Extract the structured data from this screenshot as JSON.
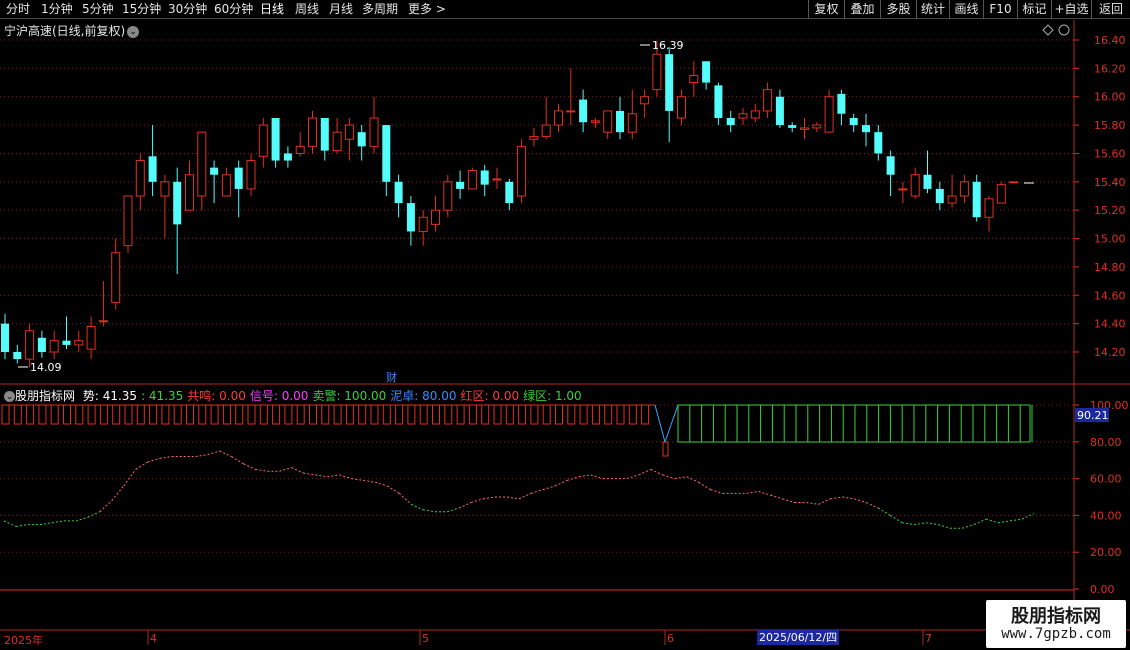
{
  "toolbar": {
    "periods": [
      "分时",
      "1分钟",
      "5分钟",
      "15分钟",
      "30分钟",
      "60分钟",
      "日线",
      "周线",
      "月线",
      "多周期",
      "更多 >"
    ],
    "actions": [
      "复权",
      "叠加",
      "多股",
      "统计",
      "画线",
      "F10",
      "标记",
      "+自选",
      "返回"
    ]
  },
  "stock": {
    "title": "宁沪高速(日线,前复权)",
    "high_label": "16.39",
    "low_label": "14.09",
    "finance_marker": "财"
  },
  "indicator": {
    "name": "股朋指标网",
    "items": [
      {
        "label": "势:",
        "value": "41.35",
        "color": "#ffffff"
      },
      {
        "label": ":",
        "value": "41.35",
        "color": "#39d23a"
      },
      {
        "label": "共鸣:",
        "value": "0.00",
        "color": "#ff3a3a"
      },
      {
        "label": "信号:",
        "value": "0.00",
        "color": "#ff3aff"
      },
      {
        "label": "卖警:",
        "value": "100.00",
        "color": "#39d23a"
      },
      {
        "label": "泥卓:",
        "value": "80.00",
        "color": "#3a8cff"
      },
      {
        "label": "红区:",
        "value": "0.00",
        "color": "#ff3a3a"
      },
      {
        "label": "绿区:",
        "value": "1.00",
        "color": "#39d23a"
      }
    ],
    "current_value": "90.21"
  },
  "price_axis": [
    "16.40",
    "16.20",
    "16.00",
    "15.80",
    "15.60",
    "15.40",
    "15.20",
    "15.00",
    "14.80",
    "14.60",
    "14.40",
    "14.20"
  ],
  "ind_axis": [
    "100.00",
    "80.00",
    "60.00",
    "40.00",
    "20.00",
    "0.00"
  ],
  "dates": {
    "year": "2025年",
    "m4": "4",
    "m5": "5",
    "m6": "6",
    "m7": "7",
    "cursor": "2025/06/12/四"
  },
  "watermark": {
    "title": "股朋指标网",
    "url": "www.7gpzb.com"
  },
  "colors": {
    "up": "#e0301e",
    "down": "#54fcfc",
    "grid": "#8b1a1a",
    "axis_text": "#e0301e"
  },
  "chart_data": {
    "type": "candlestick",
    "ylim": [
      14.09,
      16.39
    ],
    "candles": [
      [
        14.4,
        14.2,
        14.47,
        14.15
      ],
      [
        14.2,
        14.15,
        14.25,
        14.12
      ],
      [
        14.15,
        14.35,
        14.4,
        14.09
      ],
      [
        14.3,
        14.2,
        14.35,
        14.16
      ],
      [
        14.2,
        14.28,
        14.35,
        14.15
      ],
      [
        14.28,
        14.25,
        14.45,
        14.22
      ],
      [
        14.25,
        14.28,
        14.35,
        14.2
      ],
      [
        14.22,
        14.38,
        14.45,
        14.15
      ],
      [
        14.42,
        14.42,
        14.7,
        14.38
      ],
      [
        14.55,
        14.9,
        15.0,
        14.5
      ],
      [
        14.95,
        15.3,
        15.3,
        14.9
      ],
      [
        15.3,
        15.55,
        15.6,
        15.2
      ],
      [
        15.58,
        15.4,
        15.8,
        15.3
      ],
      [
        15.3,
        15.4,
        15.45,
        15.0
      ],
      [
        15.4,
        15.1,
        15.5,
        14.75
      ],
      [
        15.2,
        15.45,
        15.55,
        15.2
      ],
      [
        15.3,
        15.75,
        15.75,
        15.2
      ],
      [
        15.5,
        15.45,
        15.55,
        15.25
      ],
      [
        15.3,
        15.45,
        15.5,
        15.3
      ],
      [
        15.5,
        15.35,
        15.55,
        15.15
      ],
      [
        15.35,
        15.55,
        15.6,
        15.3
      ],
      [
        15.58,
        15.8,
        15.85,
        15.5
      ],
      [
        15.85,
        15.55,
        15.85,
        15.5
      ],
      [
        15.6,
        15.55,
        15.65,
        15.5
      ],
      [
        15.6,
        15.65,
        15.75,
        15.58
      ],
      [
        15.65,
        15.85,
        15.9,
        15.6
      ],
      [
        15.85,
        15.62,
        15.85,
        15.55
      ],
      [
        15.62,
        15.75,
        15.85,
        15.6
      ],
      [
        15.7,
        15.8,
        15.85,
        15.55
      ],
      [
        15.75,
        15.65,
        15.8,
        15.55
      ],
      [
        15.65,
        15.85,
        16.0,
        15.6
      ],
      [
        15.8,
        15.4,
        15.8,
        15.3
      ],
      [
        15.4,
        15.25,
        15.45,
        15.15
      ],
      [
        15.25,
        15.05,
        15.3,
        14.95
      ],
      [
        15.05,
        15.15,
        15.2,
        14.95
      ],
      [
        15.1,
        15.2,
        15.3,
        15.05
      ],
      [
        15.2,
        15.4,
        15.45,
        15.15
      ],
      [
        15.4,
        15.35,
        15.48,
        15.28
      ],
      [
        15.35,
        15.48,
        15.5,
        15.35
      ],
      [
        15.48,
        15.38,
        15.52,
        15.3
      ],
      [
        15.42,
        15.42,
        15.5,
        15.35
      ],
      [
        15.4,
        15.25,
        15.42,
        15.2
      ],
      [
        15.3,
        15.65,
        15.7,
        15.25
      ],
      [
        15.7,
        15.72,
        15.78,
        15.65
      ],
      [
        15.72,
        15.8,
        16.0,
        15.7
      ],
      [
        15.8,
        15.9,
        15.95,
        15.75
      ],
      [
        15.9,
        15.9,
        16.2,
        15.8
      ],
      [
        15.98,
        15.82,
        16.05,
        15.75
      ],
      [
        15.82,
        15.83,
        15.85,
        15.78
      ],
      [
        15.75,
        15.9,
        15.9,
        15.7
      ],
      [
        15.9,
        15.75,
        16.0,
        15.7
      ],
      [
        15.75,
        15.88,
        16.05,
        15.7
      ],
      [
        15.95,
        16.0,
        16.05,
        15.85
      ],
      [
        16.05,
        16.3,
        16.39,
        16.0
      ],
      [
        16.3,
        15.9,
        16.35,
        15.68
      ],
      [
        15.85,
        16.0,
        16.05,
        15.8
      ],
      [
        16.1,
        16.15,
        16.25,
        16.0
      ],
      [
        16.25,
        16.1,
        16.25,
        16.05
      ],
      [
        16.08,
        15.85,
        16.1,
        15.8
      ],
      [
        15.85,
        15.8,
        15.9,
        15.75
      ],
      [
        15.85,
        15.88,
        15.92,
        15.8
      ],
      [
        15.85,
        15.9,
        15.95,
        15.82
      ],
      [
        15.9,
        16.05,
        16.1,
        15.85
      ],
      [
        16.0,
        15.8,
        16.05,
        15.78
      ],
      [
        15.8,
        15.78,
        15.82,
        15.75
      ],
      [
        15.77,
        15.78,
        15.85,
        15.7
      ],
      [
        15.78,
        15.8,
        15.82,
        15.75
      ],
      [
        15.75,
        16.0,
        16.05,
        15.75
      ],
      [
        16.02,
        15.88,
        16.05,
        15.8
      ],
      [
        15.85,
        15.8,
        15.88,
        15.75
      ],
      [
        15.8,
        15.75,
        15.88,
        15.65
      ],
      [
        15.75,
        15.6,
        15.8,
        15.55
      ],
      [
        15.58,
        15.45,
        15.62,
        15.3
      ],
      [
        15.35,
        15.35,
        15.4,
        15.25
      ],
      [
        15.3,
        15.45,
        15.5,
        15.28
      ],
      [
        15.45,
        15.35,
        15.62,
        15.32
      ],
      [
        15.35,
        15.25,
        15.4,
        15.2
      ],
      [
        15.25,
        15.3,
        15.45,
        15.22
      ],
      [
        15.3,
        15.4,
        15.45,
        15.25
      ],
      [
        15.4,
        15.15,
        15.45,
        15.12
      ],
      [
        15.15,
        15.28,
        15.3,
        15.05
      ],
      [
        15.25,
        15.38,
        15.4,
        15.25
      ],
      [
        15.4,
        15.4,
        15.4,
        15.4
      ]
    ],
    "indicator_line": [
      37,
      34,
      35,
      35,
      36,
      37,
      37,
      39,
      42,
      48,
      56,
      65,
      69,
      71,
      72,
      72,
      72,
      73,
      75,
      72,
      68,
      65,
      64,
      64,
      66,
      63,
      62,
      61,
      62,
      60,
      59,
      58,
      56,
      52,
      46,
      43,
      42,
      42,
      44,
      47,
      49,
      50,
      50,
      49,
      52,
      54,
      56,
      59,
      61,
      62,
      60,
      60,
      60,
      62,
      65,
      62,
      60,
      61,
      58,
      54,
      52,
      52,
      52,
      53,
      51,
      49,
      47,
      47,
      46,
      49,
      50,
      49,
      47,
      44,
      40,
      36,
      35,
      36,
      35,
      33,
      33,
      35,
      38,
      36,
      37,
      38,
      41
    ],
    "red_zone_count": 53,
    "green_zone_count": 31
  }
}
